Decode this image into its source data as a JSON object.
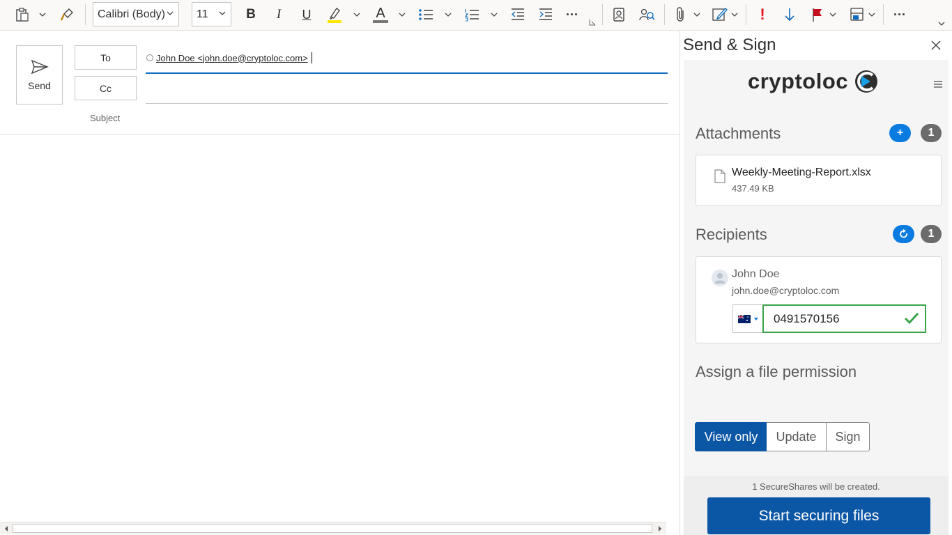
{
  "ribbon": {
    "font_name": "Calibri (Body)",
    "font_size": "11",
    "bold_label": "B",
    "italic_label": "I",
    "underline_label": "U",
    "font_color_label": "A",
    "more_label": "···",
    "importance_label": "!",
    "colors": {
      "highlight": "#ffe600",
      "importance": "#e81123",
      "flag": "#c50f1f",
      "accent": "#0f6cbd"
    }
  },
  "compose": {
    "send_label": "Send",
    "to_label": "To",
    "cc_label": "Cc",
    "subject_label": "Subject",
    "to_recipient": "John Doe <john.doe@cryptoloc.com>"
  },
  "pane": {
    "title": "Send & Sign",
    "logo_text": "cryptoloc",
    "attachments": {
      "title": "Attachments",
      "add_label": "+",
      "count": "1",
      "file": {
        "name": "Weekly-Meeting-Report.xlsx",
        "size": "437.49 KB"
      }
    },
    "recipients": {
      "title": "Recipients",
      "count": "1",
      "recipient": {
        "name": "John Doe",
        "email": "john.doe@cryptoloc.com",
        "phone": "0491570156"
      }
    },
    "permission": {
      "title": "Assign a file permission",
      "options": [
        "View only",
        "Update",
        "Sign"
      ],
      "selected": "View only"
    },
    "footer": {
      "info": "1 SecureShares will be created.",
      "start_label": "Start securing files"
    }
  }
}
